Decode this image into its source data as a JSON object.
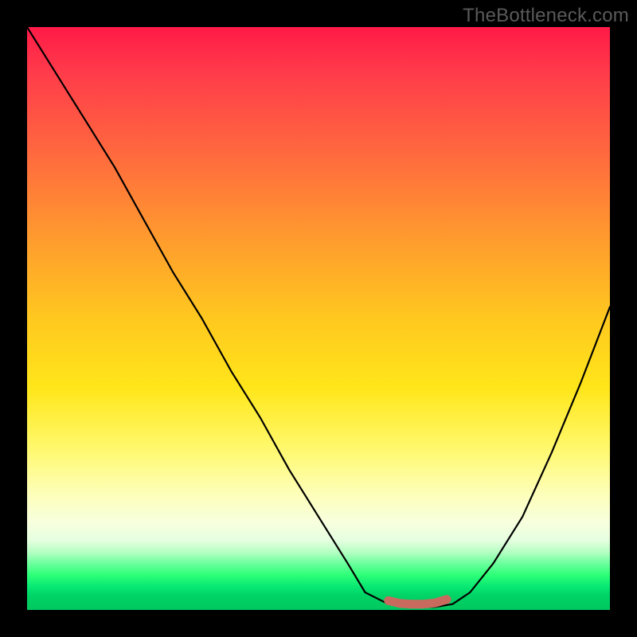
{
  "watermark": {
    "text": "TheBottleneck.com"
  },
  "chart_data": {
    "type": "line",
    "title": "",
    "xlabel": "",
    "ylabel": "",
    "xlim": [
      0,
      100
    ],
    "ylim": [
      0,
      100
    ],
    "grid": false,
    "legend": false,
    "series": [
      {
        "name": "bottleneck-curve",
        "color": "#000000",
        "x": [
          0,
          5,
          10,
          15,
          20,
          25,
          30,
          35,
          40,
          45,
          50,
          55,
          58,
          62,
          66,
          70,
          73,
          76,
          80,
          85,
          90,
          95,
          100
        ],
        "y": [
          100,
          92,
          84,
          76,
          67,
          58,
          50,
          41,
          33,
          24,
          16,
          8,
          3,
          1,
          0.5,
          0.5,
          1,
          3,
          8,
          16,
          27,
          39,
          52
        ]
      },
      {
        "name": "optimal-marker",
        "color": "#c96a5e",
        "x": [
          62,
          64,
          66,
          68,
          70,
          72
        ],
        "y": [
          1.6,
          1.1,
          1.0,
          1.0,
          1.2,
          1.8
        ]
      }
    ],
    "gradient_stops": [
      {
        "pos": 0,
        "color": "#ff1a47"
      },
      {
        "pos": 50,
        "color": "#ffc81f"
      },
      {
        "pos": 85,
        "color": "#f7ffde"
      },
      {
        "pos": 100,
        "color": "#00c75f"
      }
    ]
  }
}
